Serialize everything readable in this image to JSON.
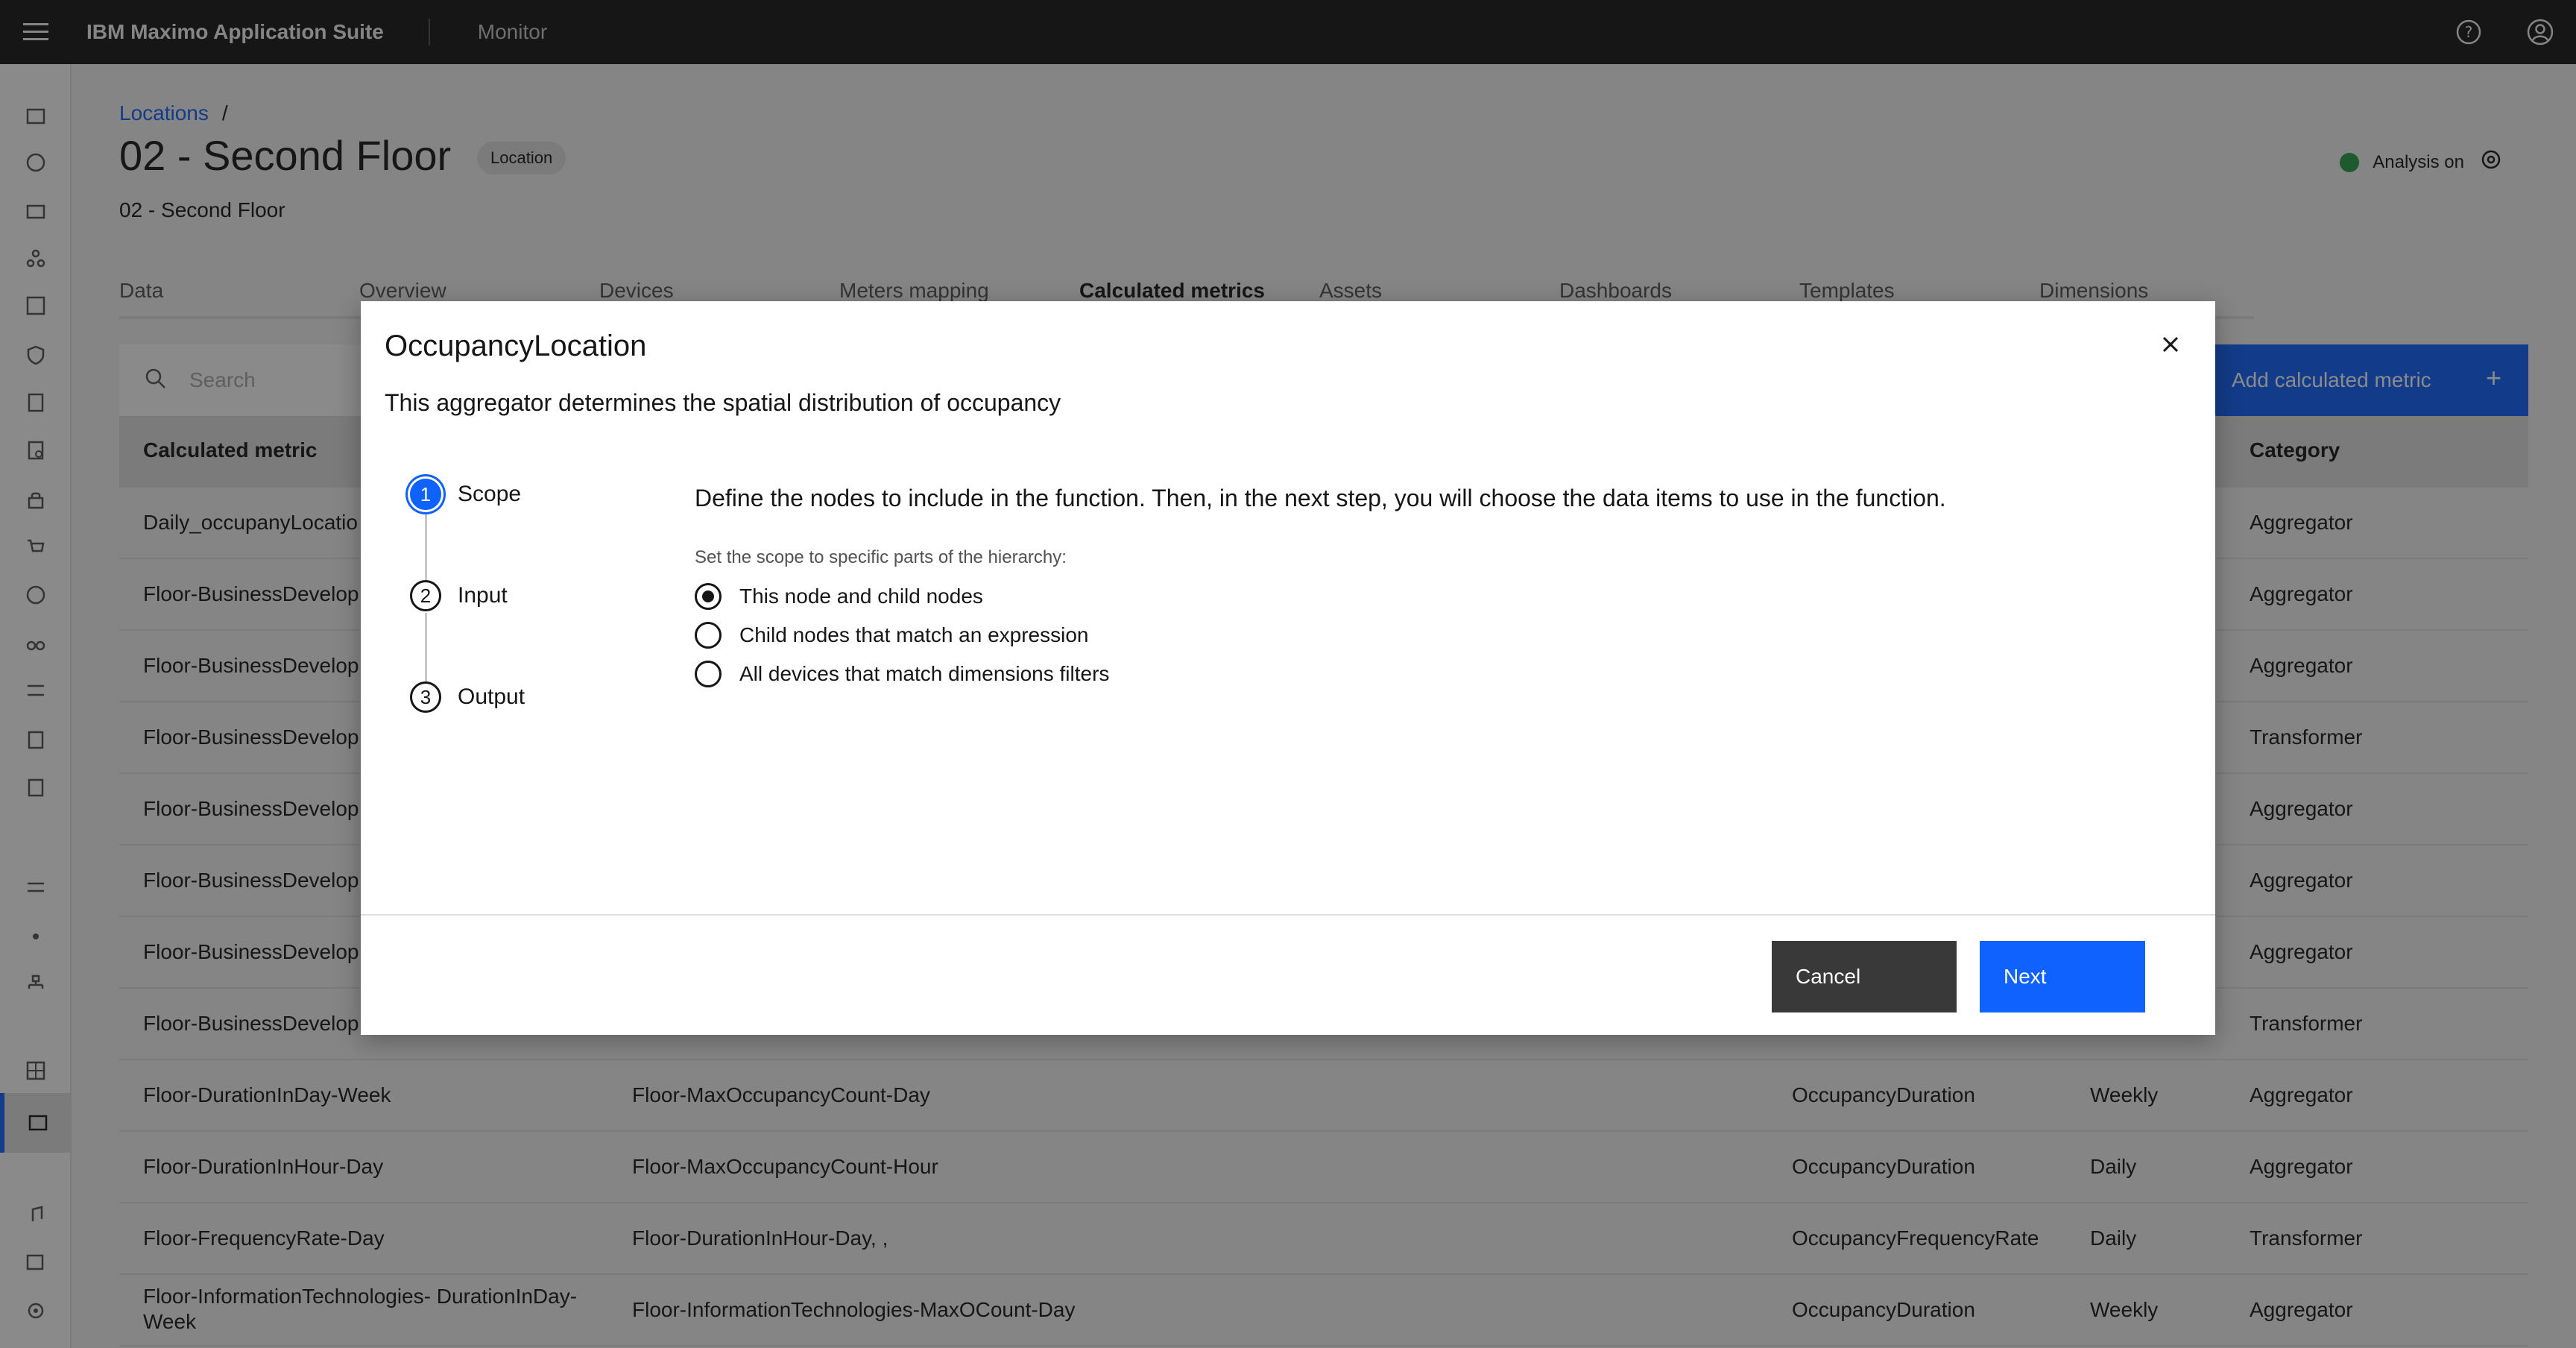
{
  "header": {
    "brand_bold": "IBM Maximo Application Suite",
    "product": "Monitor",
    "icons": [
      "menu-icon",
      "help-icon",
      "user-icon"
    ]
  },
  "page": {
    "breadcrumb": "Locations",
    "breadcrumb_sep": "/",
    "title": "02 - Second Floor",
    "tag": "Location",
    "subtitle": "02 - Second Floor",
    "analysis_label": "Analysis on",
    "analysis_color": "#24a148"
  },
  "tabs": [
    "Data",
    "Overview",
    "Devices",
    "Meters mapping",
    "Calculated metrics",
    "Assets",
    "Dashboards",
    "Templates",
    "Dimensions"
  ],
  "active_tab": "Calculated metrics",
  "toolbar": {
    "search_placeholder": "Search",
    "add_label": "Add calculated metric",
    "add_plus": "+"
  },
  "table": {
    "headers": [
      "Calculated metric",
      "",
      "",
      "",
      "Category"
    ],
    "rows": [
      {
        "name": "Daily_occupanyLocatio",
        "input": "",
        "function": "",
        "frequency": "",
        "category": "Aggregator"
      },
      {
        "name": "Floor-BusinessDevelop Week",
        "input": "",
        "function": "",
        "frequency": "",
        "category": "Aggregator"
      },
      {
        "name": "Floor-BusinessDevelop Day",
        "input": "",
        "function": "",
        "frequency": "",
        "category": "Aggregator"
      },
      {
        "name": "Floor-BusinessDevelop",
        "input": "",
        "function": "",
        "frequency": "",
        "category": "Transformer"
      },
      {
        "name": "Floor-BusinessDevelop",
        "input": "",
        "function": "",
        "frequency": "",
        "category": "Aggregator"
      },
      {
        "name": "Floor-BusinessDevelop Hour",
        "input": "",
        "function": "",
        "frequency": "",
        "category": "Aggregator"
      },
      {
        "name": "Floor-BusinessDevelop",
        "input": "",
        "function": "",
        "frequency": "",
        "category": "Aggregator"
      },
      {
        "name": "Floor-BusinessDevelop",
        "input": "",
        "function": "",
        "frequency": "",
        "category": "Transformer"
      },
      {
        "name": "Floor-DurationInDay-Week",
        "input": "Floor-MaxOccupancyCount-Day",
        "function": "OccupancyDuration",
        "frequency": "Weekly",
        "category": "Aggregator"
      },
      {
        "name": "Floor-DurationInHour-Day",
        "input": "Floor-MaxOccupancyCount-Hour",
        "function": "OccupancyDuration",
        "frequency": "Daily",
        "category": "Aggregator"
      },
      {
        "name": "Floor-FrequencyRate-Day",
        "input": "Floor-DurationInHour-Day, ,",
        "function": "OccupancyFrequencyRate",
        "frequency": "Daily",
        "category": "Transformer"
      },
      {
        "name": "Floor-InformationTechnologies- DurationInDay-Week",
        "input": "Floor-InformationTechnologies-MaxOCount-Day",
        "function": "OccupancyDuration",
        "frequency": "Weekly",
        "category": "Aggregator"
      }
    ]
  },
  "modal": {
    "title": "OccupancyLocation",
    "description": "This aggregator determines the spatial distribution of occupancy",
    "steps": [
      {
        "num": "1",
        "label": "Scope"
      },
      {
        "num": "2",
        "label": "Input"
      },
      {
        "num": "3",
        "label": "Output"
      }
    ],
    "heading": "Define the nodes to include in the function. Then, in the next step, you will choose the data items to use in the function.",
    "scope_label": "Set the scope to specific parts of the hierarchy:",
    "options": [
      {
        "label": "This node and child nodes",
        "checked": true
      },
      {
        "label": "Child nodes that match an expression",
        "checked": false
      },
      {
        "label": "All devices that match dimensions filters",
        "checked": false
      }
    ],
    "cancel_label": "Cancel",
    "next_label": "Next",
    "accent": "#0f62fe"
  }
}
